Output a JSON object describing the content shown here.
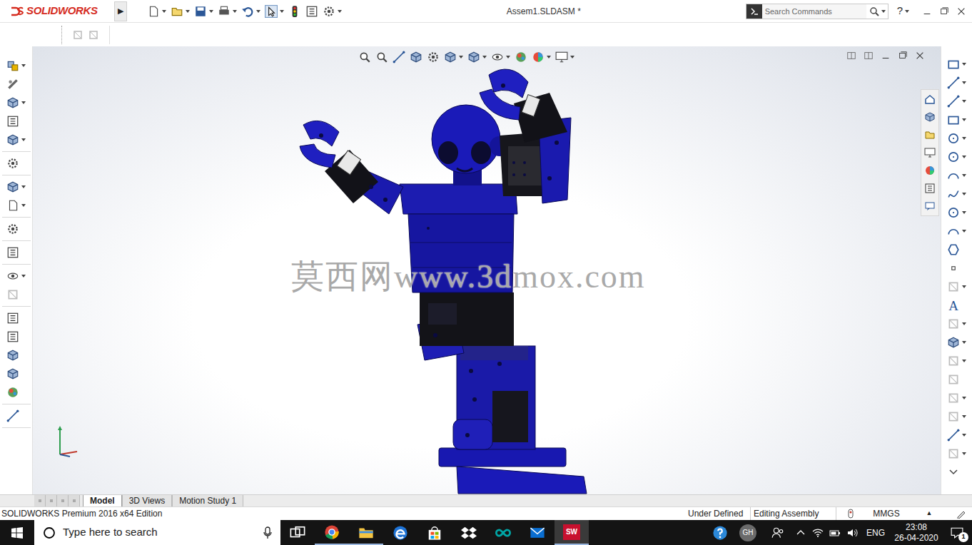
{
  "app": {
    "logo": "SOLIDWORKS",
    "menu_arrow": "▶"
  },
  "window": {
    "title": "Assem1.SLDASM *"
  },
  "search": {
    "placeholder": "Search Commands"
  },
  "help": "?",
  "viewport": {
    "watermark": "莫西网www.3dmox.com"
  },
  "right_toolbar": {
    "text_tool": "A"
  },
  "tabs": [
    {
      "label": "Model",
      "selected": true
    },
    {
      "label": "3D Views",
      "selected": false
    },
    {
      "label": "Motion Study 1",
      "selected": false
    }
  ],
  "status_bar": {
    "edition": "SOLIDWORKS Premium 2016 x64 Edition",
    "state": "Under Defined",
    "mode": "Editing Assembly",
    "units": "MMGS",
    "units_arrow": "▲"
  },
  "taskbar": {
    "search_placeholder": "Type here to search",
    "sw_icon": "SW",
    "user": "GH",
    "language": "ENG",
    "time": "23:08",
    "date": "26-04-2020",
    "notifications": "1"
  }
}
